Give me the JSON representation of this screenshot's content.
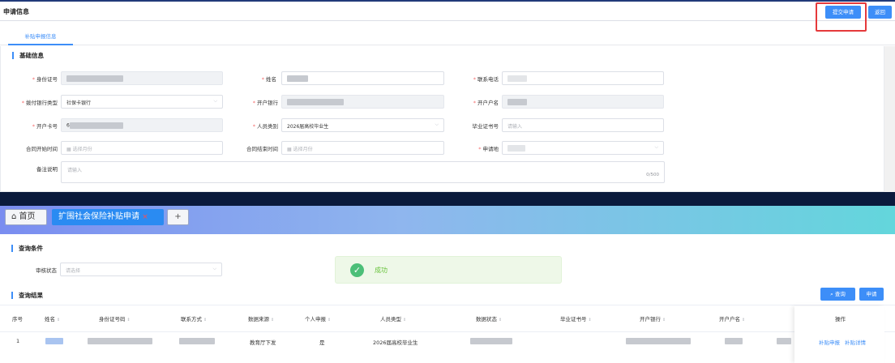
{
  "header": {
    "title": "申请信息",
    "submit_label": "提交申请",
    "back_label": "返回"
  },
  "tabs": [
    {
      "label": "补贴申报信息"
    }
  ],
  "basic": {
    "title": "基础信息",
    "id_label": "身份证号",
    "name_label": "姓名",
    "phone_label": "联系电话",
    "bank_type_label": "拨付银行类型",
    "bank_type_value": "社保卡银行",
    "bank_label": "开户银行",
    "account_name_label": "开户户名",
    "card_label": "开户卡号",
    "card_prefix": "6",
    "person_type_label": "人员类别",
    "person_type_value": "2026届高校毕业生",
    "cert_label": "毕业证书号",
    "cert_placeholder": "请输入",
    "contract_start_label": "合同开始时间",
    "contract_end_label": "合同结束时间",
    "month_placeholder": "选择月份",
    "apply_place_label": "申请地",
    "remark_label": "备注说明",
    "remark_placeholder": "请输入",
    "remark_count": "0/500"
  },
  "nav": {
    "home_label": "首页",
    "active_tab": "扩围社会保险补贴申请",
    "close": "×",
    "add": "+"
  },
  "query": {
    "title": "查询条件",
    "status_label": "审核状态",
    "status_placeholder": "请选择",
    "results_title": "查询结果",
    "search_label": "查询",
    "apply_label": "申请"
  },
  "toast": {
    "text": "成功"
  },
  "table": {
    "headers": [
      "序号",
      "姓名",
      "身份证号码",
      "联系方式",
      "数据来源",
      "个人申报",
      "人员类型",
      "数据状态",
      "毕业证书号",
      "开户银行",
      "开户户名",
      "操作"
    ],
    "row": {
      "index": "1",
      "source": "教育厅下发",
      "personal": "是",
      "type": "2026届高校毕业生",
      "action1": "补贴申报",
      "action2": "补贴详情"
    }
  }
}
